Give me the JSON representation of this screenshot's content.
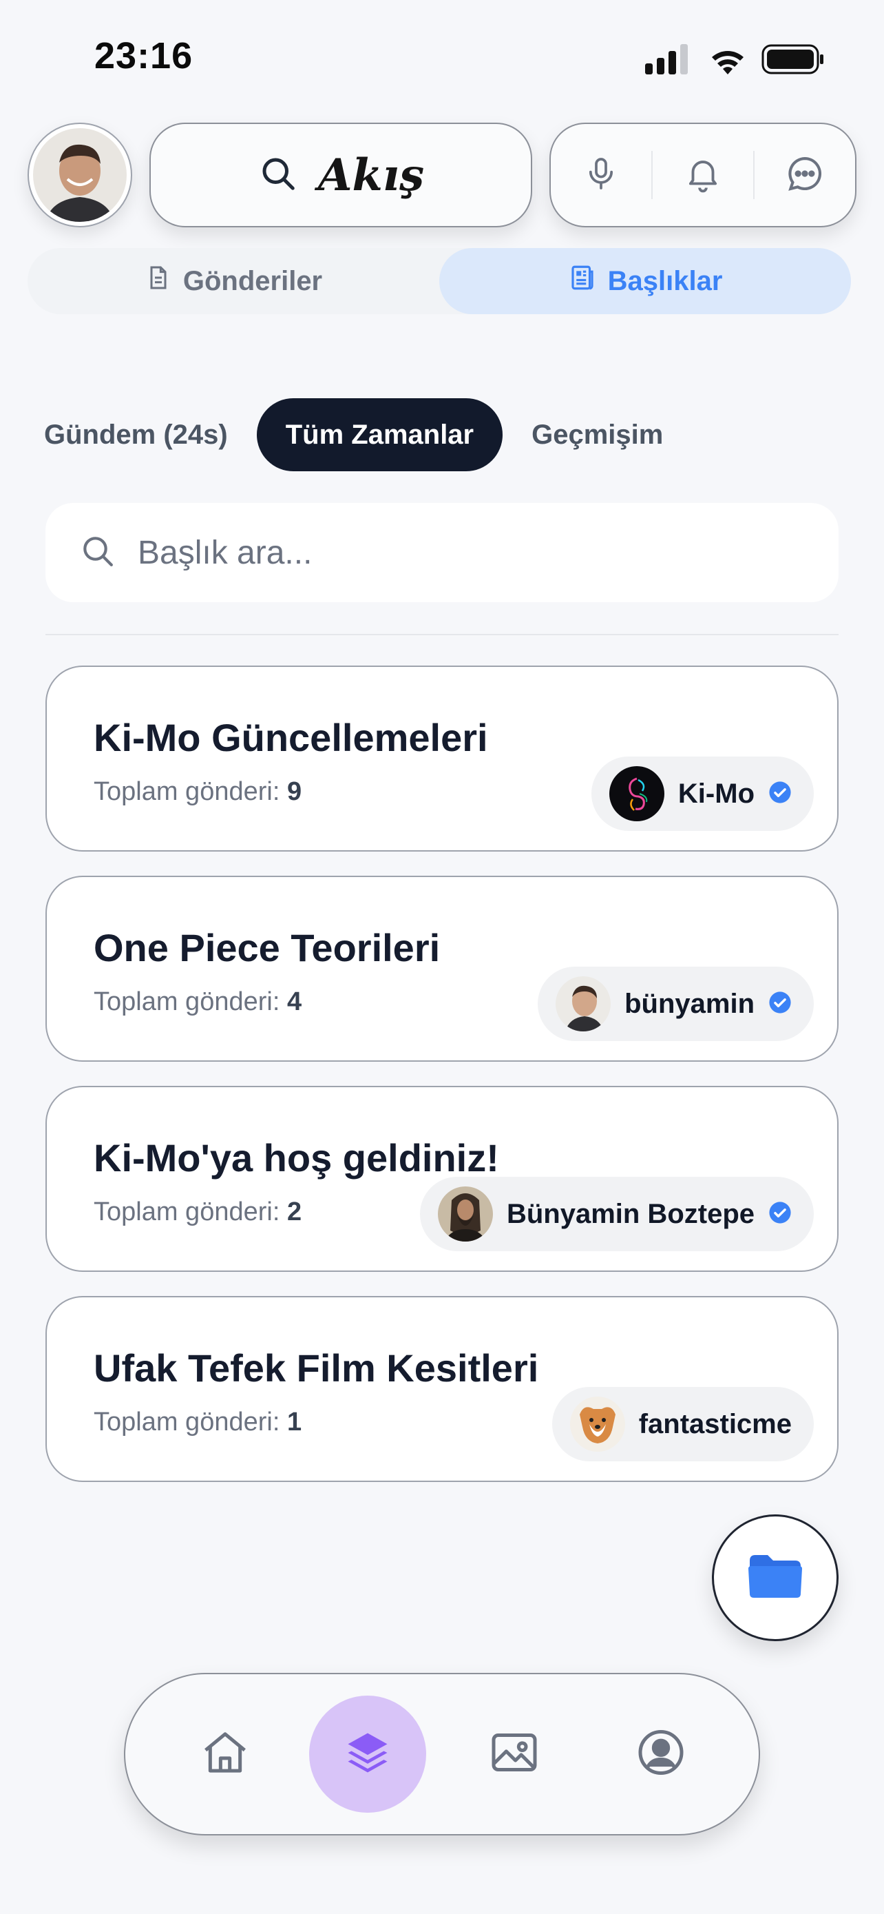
{
  "status_bar": {
    "time": "23:16"
  },
  "header": {
    "logo_text": "Akış",
    "icons": [
      "search-icon",
      "microphone-icon",
      "bell-icon",
      "chat-bubble-icon"
    ]
  },
  "view_tabs": [
    {
      "label": "Gönderiler",
      "icon": "document-icon",
      "active": false
    },
    {
      "label": "Başlıklar",
      "icon": "newspaper-icon",
      "active": true
    }
  ],
  "filters": [
    {
      "label": "Gündem (24s)",
      "active": false
    },
    {
      "label": "Tüm Zamanlar",
      "active": true
    },
    {
      "label": "Geçmişim",
      "active": false
    }
  ],
  "search": {
    "placeholder": "Başlık ara..."
  },
  "topics": [
    {
      "title": "Ki-Mo Güncellemeleri",
      "count_label": "Toplam gönderi:",
      "count": "9",
      "author": "Ki-Mo",
      "verified": true
    },
    {
      "title": "One Piece Teorileri",
      "count_label": "Toplam gönderi:",
      "count": "4",
      "author": "bünyamin",
      "verified": true
    },
    {
      "title": "Ki-Mo'ya hoş geldiniz!",
      "count_label": "Toplam gönderi:",
      "count": "2",
      "author": "Bünyamin Boztepe",
      "verified": true
    },
    {
      "title": "Ufak Tefek Film Kesitleri",
      "count_label": "Toplam gönderi:",
      "count": "1",
      "author": "fantasticme",
      "verified": false
    }
  ],
  "bottom_nav": [
    {
      "icon": "home-icon",
      "active": false
    },
    {
      "icon": "layers-icon",
      "active": true
    },
    {
      "icon": "image-icon",
      "active": false
    },
    {
      "icon": "user-circle-icon",
      "active": false
    }
  ],
  "colors": {
    "accent": "#3b82f6",
    "dark_chip": "#121a2c",
    "active_tab_bg": "#dbe8fb",
    "nav_active_bg": "#d8c4f8",
    "nav_active_icon": "#8b5cf6"
  }
}
